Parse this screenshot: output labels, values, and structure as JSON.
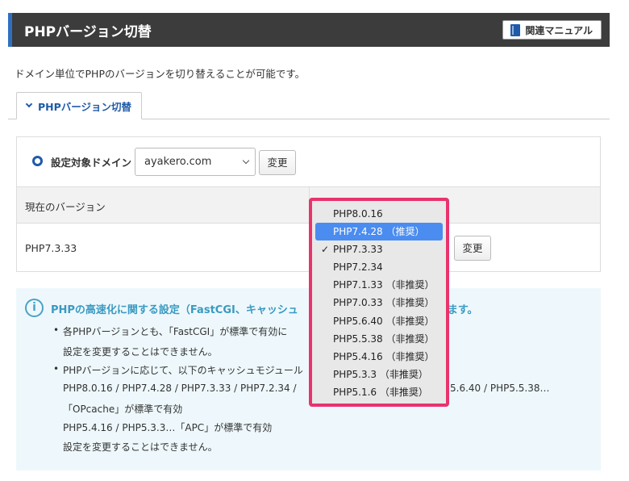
{
  "header": {
    "title": "PHPバージョン切替",
    "manual_label": "関連マニュアル"
  },
  "description": "ドメイン単位でPHPのバージョンを切り替えることが可能です。",
  "tab": {
    "label": "PHPバージョン切替"
  },
  "domain": {
    "label": "設定対象ドメイン",
    "selected": "ayakero.com",
    "change_label": "変更"
  },
  "version": {
    "header": "現在のバージョン",
    "current": "PHP7.3.33",
    "change_label": "変更"
  },
  "dropdown": {
    "options": [
      {
        "label": "PHP8.0.16",
        "state": ""
      },
      {
        "label": "PHP7.4.28 （推奨）",
        "state": "highlighted"
      },
      {
        "label": "PHP7.3.33",
        "state": "checked"
      },
      {
        "label": "PHP7.2.34",
        "state": ""
      },
      {
        "label": "PHP7.1.33 （非推奨）",
        "state": ""
      },
      {
        "label": "PHP7.0.33 （非推奨）",
        "state": ""
      },
      {
        "label": "PHP5.6.40 （非推奨）",
        "state": ""
      },
      {
        "label": "PHP5.5.38 （非推奨）",
        "state": ""
      },
      {
        "label": "PHP5.4.16 （非推奨）",
        "state": ""
      },
      {
        "label": "PHP5.3.3 （非推奨）",
        "state": ""
      },
      {
        "label": "PHP5.1.6 （非推奨）",
        "state": ""
      }
    ],
    "check_mark": "✓",
    "border_color": "#e8336d",
    "highlight_color": "#4a8cf0"
  },
  "info": {
    "icon": "i",
    "title_left": "PHPの高速化に関する設定（FastCGI、キャッシュ",
    "title_right": "になります。",
    "lines": {
      "l1a": "各PHPバージョンとも、「FastCGI」が標準で有効に",
      "l1b": "設定を変更することはできません。",
      "l2a": "PHPバージョンに応じて、以下のキャッシュモジュール",
      "l2b_left": "PHP8.0.16 / PHP7.4.28 / PHP7.3.33 / PHP7.2.34 /",
      "l2b_right": "5.6.40 / PHP5.5.38…",
      "l2c": "「OPcache」が標準で有効",
      "l2d": "PHP5.4.16 / PHP5.3.3…「APC」が標準で有効",
      "l2e": "設定を変更することはできません。"
    }
  }
}
